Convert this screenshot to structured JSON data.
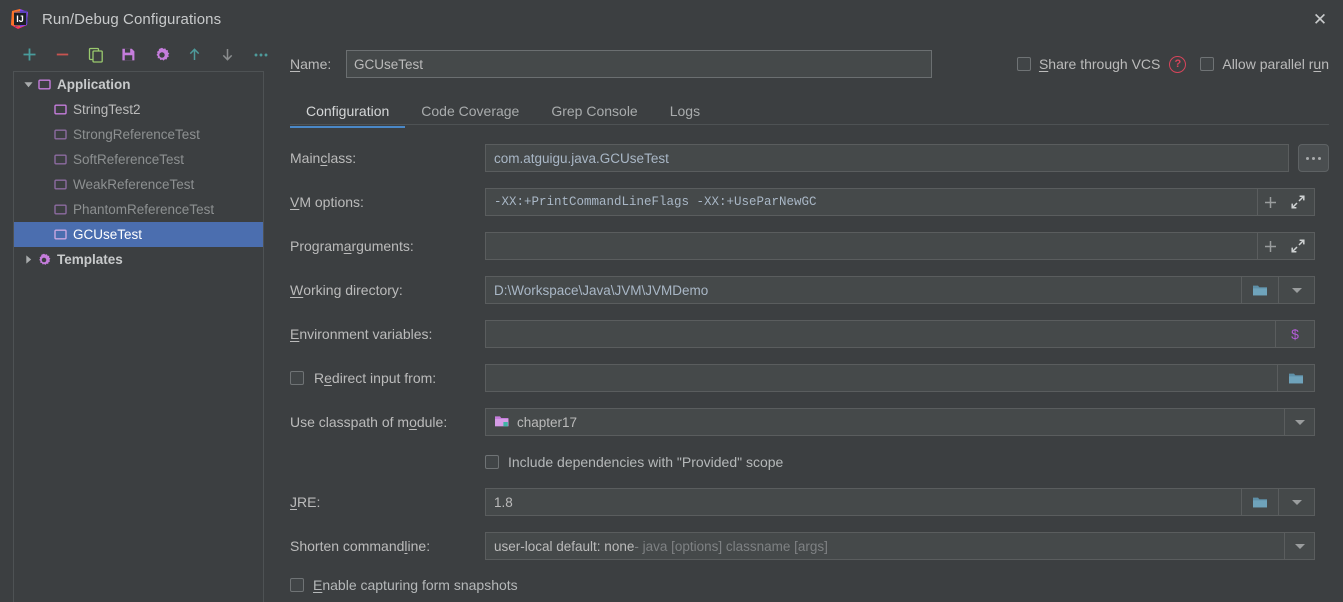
{
  "window": {
    "title": "Run/Debug Configurations",
    "logo_icon": "intellij-idea-logo",
    "close_icon": "close-icon"
  },
  "toolbar": {
    "buttons": [
      {
        "name": "add-configuration-button",
        "icon": "plus-icon",
        "color": "#499c9c"
      },
      {
        "name": "remove-configuration-button",
        "icon": "minus-icon",
        "color": "#c75450"
      },
      {
        "name": "copy-configuration-button",
        "icon": "copy-icon",
        "color": "#9aca6e"
      },
      {
        "name": "save-configuration-button",
        "icon": "save-icon",
        "color": "#c57ddc"
      },
      {
        "name": "edit-templates-button",
        "icon": "gear-icon",
        "color": "#c57ddc"
      },
      {
        "name": "move-up-button",
        "icon": "arrow-up-icon",
        "color": "#4e9a9a"
      },
      {
        "name": "move-down-button",
        "icon": "arrow-down-icon",
        "color": "#8a8d8e"
      },
      {
        "name": "more-options-button",
        "icon": "ellipsis-icon",
        "color": "#4e9a9a"
      }
    ]
  },
  "tree": {
    "items": [
      {
        "label": "Application",
        "level": 0,
        "expander": "expanded",
        "icon": "application-folder-icon",
        "style": "group",
        "selected": false
      },
      {
        "label": "StringTest2",
        "level": 1,
        "expander": "none",
        "icon": "run-config-icon",
        "style": "bright",
        "selected": false
      },
      {
        "label": "StrongReferenceTest",
        "level": 1,
        "expander": "none",
        "icon": "run-config-icon",
        "style": "dim",
        "selected": false
      },
      {
        "label": "SoftReferenceTest",
        "level": 1,
        "expander": "none",
        "icon": "run-config-icon",
        "style": "dim",
        "selected": false
      },
      {
        "label": "WeakReferenceTest",
        "level": 1,
        "expander": "none",
        "icon": "run-config-icon",
        "style": "dim",
        "selected": false
      },
      {
        "label": "PhantomReferenceTest",
        "level": 1,
        "expander": "none",
        "icon": "run-config-icon",
        "style": "dim",
        "selected": false
      },
      {
        "label": "GCUseTest",
        "level": 1,
        "expander": "none",
        "icon": "run-config-icon",
        "style": "bright",
        "selected": true
      },
      {
        "label": "Templates",
        "level": 0,
        "expander": "collapsed",
        "icon": "templates-gear-icon",
        "style": "group",
        "selected": false
      }
    ],
    "selection_color": "#4b6eaf"
  },
  "name_row": {
    "label": "Name:",
    "value": "GCUseTest",
    "placeholder": "",
    "share_checkbox": {
      "label_prefix": "S",
      "label": "hare through VCS",
      "checked": false
    },
    "help_icon": "help-question-icon",
    "help_color": "#d6455b",
    "parallel_checkbox": {
      "label": "Allow parallel r",
      "label_mnemonic": "u",
      "label_suffix": "n",
      "checked": false
    }
  },
  "tabs": [
    {
      "label": "Configuration",
      "active": true
    },
    {
      "label": "Code Coverage",
      "active": false
    },
    {
      "label": "Grep Console",
      "active": false
    },
    {
      "label": "Logs",
      "active": false
    }
  ],
  "form": {
    "main_class": {
      "label_pre": "Main ",
      "label_mn": "c",
      "label_post": "lass:",
      "value": "com.atguigu.java.GCUseTest",
      "annotated": true,
      "browse_button": "browse-dots-button"
    },
    "vm_options": {
      "label_pre": "",
      "label_mn": "V",
      "label_post": "M options:",
      "value": "-XX:+PrintCommandLineFlags -XX:+UseParNewGC",
      "annotated": true,
      "buttons": [
        "plus-icon",
        "expand-icon"
      ]
    },
    "program_arguments": {
      "label_pre": "Program ",
      "label_mn": "a",
      "label_post": "rguments:",
      "value": "",
      "annotated": false,
      "buttons": [
        "plus-icon",
        "expand-icon"
      ]
    },
    "working_directory": {
      "label_pre": "",
      "label_mn": "W",
      "label_post": "orking directory:",
      "value": "D:\\Workspace\\Java\\JVM\\JVMDemo",
      "annotated": false,
      "buttons": [
        "folder-icon",
        "chevron-down-icon"
      ]
    },
    "environment_variables": {
      "label_pre": "",
      "label_mn": "E",
      "label_post": "nvironment variables:",
      "value": "",
      "annotated": false,
      "buttons": [
        "dollar-macro-icon"
      ]
    },
    "redirect_input": {
      "label_pre": "Redirect input from:",
      "label_mn": "",
      "label_post": "",
      "checked": false,
      "value": "",
      "annotated": false,
      "buttons": [
        "folder-icon"
      ]
    },
    "use_classpath_of_module": {
      "label_pre": "Use classpath of m",
      "label_mn": "o",
      "label_post": "dule:",
      "value": "chapter17",
      "value_icon": "module-folder-icon",
      "annotated": false,
      "buttons": [
        "chevron-down-icon"
      ]
    },
    "include_dependencies": {
      "label": "Include dependencies with \"Provided\" scope",
      "checked": false
    },
    "jre": {
      "label_pre": "",
      "label_mn": "J",
      "label_post": "RE:",
      "value": "1.8",
      "annotated": true,
      "buttons": [
        "folder-icon",
        "chevron-down-icon"
      ]
    },
    "shorten_command_line": {
      "label_pre": "Shorten command ",
      "label_mn": "l",
      "label_post": "ine:",
      "value": "user-local default: none",
      "value_hint": " - java [options] classname [args]",
      "annotated": false,
      "buttons": [
        "chevron-down-icon"
      ]
    },
    "enable_form_snapshots": {
      "label_pre": "",
      "label_mn": "E",
      "label_post": "nable capturing form snapshots",
      "checked": false
    }
  },
  "colors": {
    "background": "#3c3f41",
    "field_background": "#45494a",
    "field_border": "#5a5d5e",
    "text": "#bbbbbb",
    "value_text": "#a9b7c6",
    "accent_tab": "#4a88c7",
    "selection": "#4b6eaf",
    "annotation_arrow": "#e01b24"
  }
}
